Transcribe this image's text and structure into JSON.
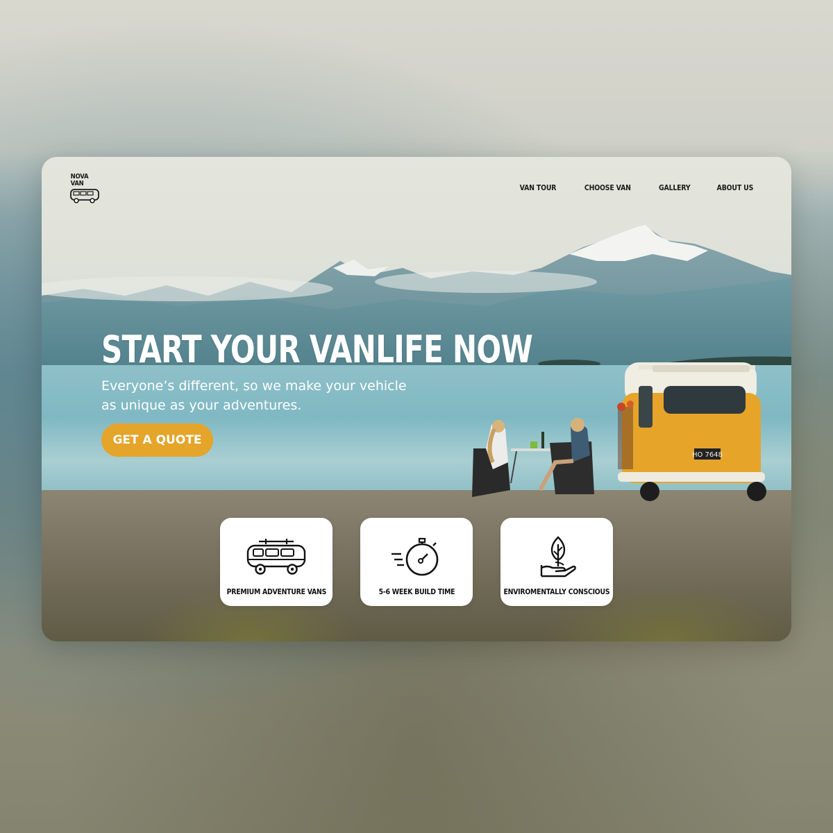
{
  "brand": {
    "name": "NOVA VAN",
    "logo_icon": "van-icon"
  },
  "nav": {
    "items": [
      "VAN TOUR",
      "CHOOSE VAN",
      "GALLERY",
      "ABOUT US"
    ]
  },
  "hero": {
    "title": "START YOUR VANLIFE NOW",
    "subtitle": "Everyone’s different, so we make your vehicle as unique as your adventures.",
    "cta": "GET A QUOTE"
  },
  "van": {
    "plate": "HO 7648"
  },
  "features": [
    {
      "label": "PREMIUM ADVENTURE VANS",
      "icon": "van-icon"
    },
    {
      "label": "5-6 WEEK BUILD TIME",
      "icon": "stopwatch-icon"
    },
    {
      "label": "ENVIROMENTALLY CONSCIOUS",
      "icon": "plant-in-hand-icon"
    }
  ],
  "colors": {
    "accent": "#E5A42A",
    "text_light": "#FFFFFF",
    "text_dark": "#1C1C1C",
    "card_bg": "#FFFFFF",
    "van_body": "#E6A429"
  }
}
